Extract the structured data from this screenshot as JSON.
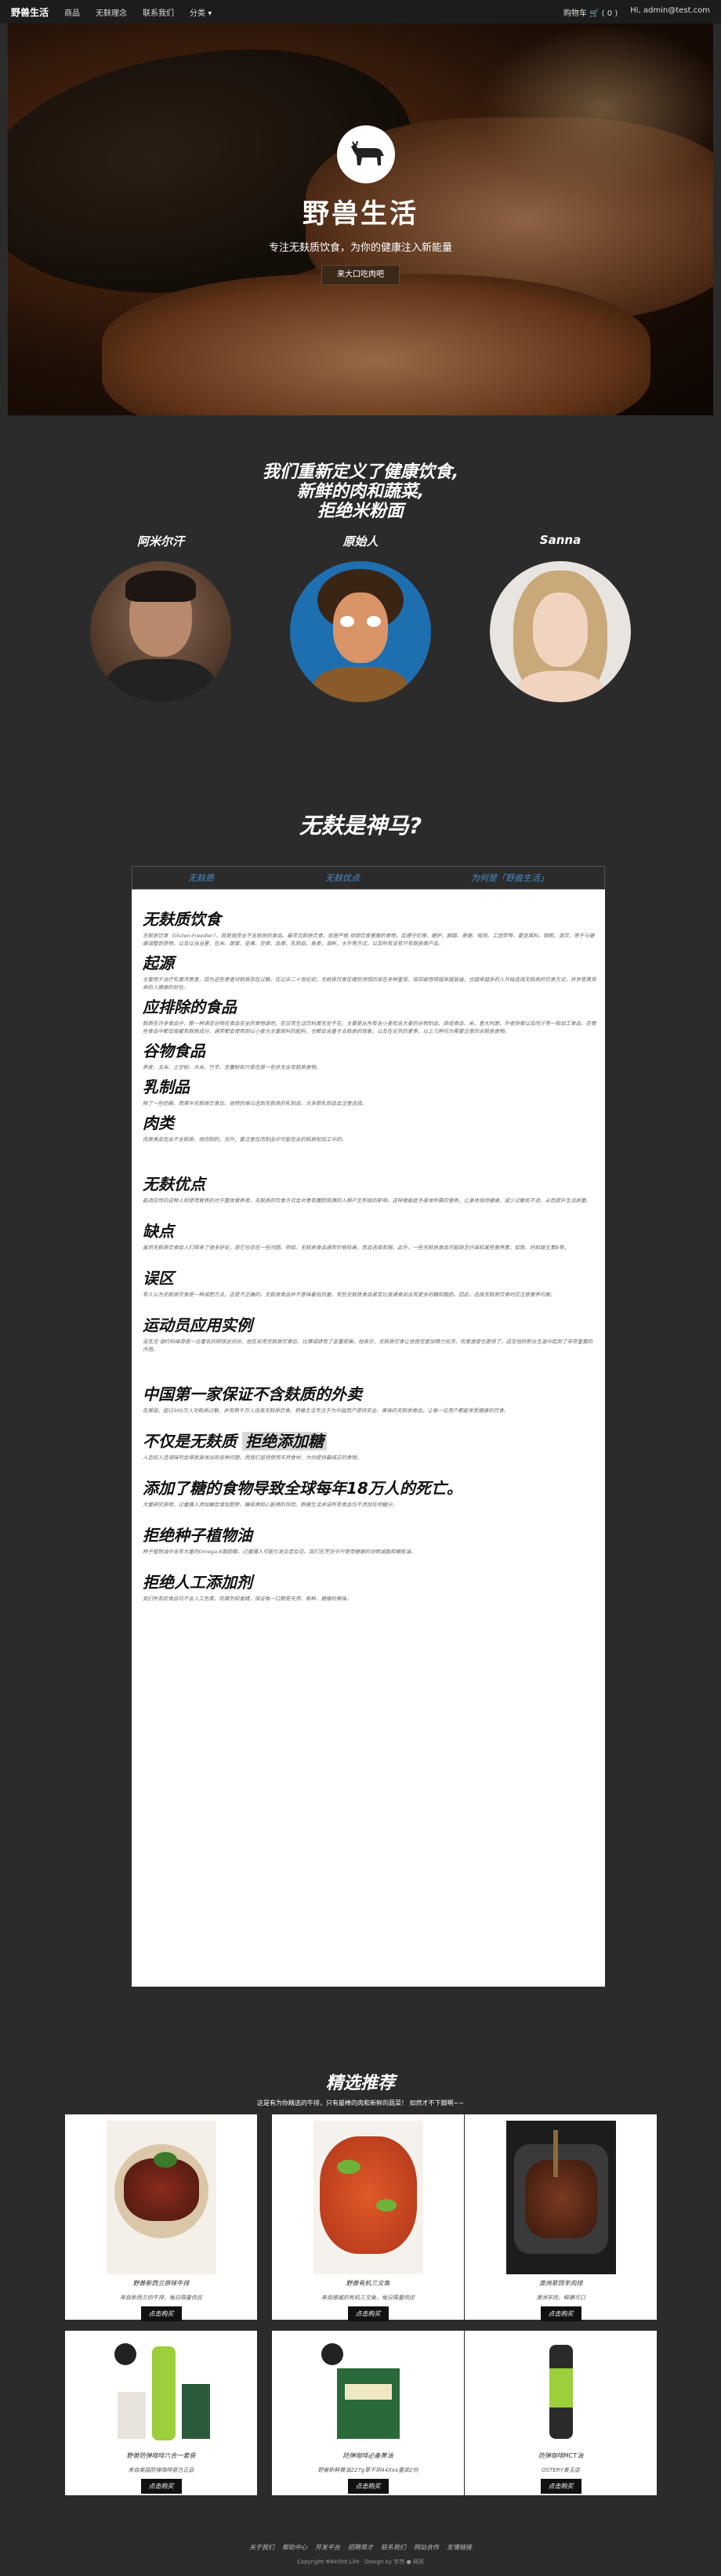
{
  "nav": {
    "brand": "野兽生活",
    "items": [
      "商品",
      "无麸理念",
      "联系我们",
      "分类 ▾"
    ],
    "cart": "购物车 🛒 ( 0 )",
    "user": "Hi, admin@test.com"
  },
  "hero": {
    "title": "野兽生活",
    "subtitle": "专注无麸质饮食，为你的健康注入新能量",
    "button": "来大口吃肉吧"
  },
  "intro": {
    "line1": "我们重新定义了健康饮食,",
    "line2": "新鲜的肉和蔬菜,",
    "line3": "拒绝米粉面"
  },
  "people": [
    {
      "name": "阿米尔汗"
    },
    {
      "name": "原始人"
    },
    {
      "name": "Sanna"
    }
  ],
  "what": {
    "title": "无麸是神马?",
    "tabs": [
      "无麸质",
      "无麸优点",
      "为何是「野兽生活」"
    ]
  },
  "article": [
    {
      "h": "无麸质饮食",
      "p": "无麸质饮食（Gluten-Freedier），就是指完全不含麸质的食品。最常见麸质饮食，就是严格 视频饮食里面的食物，且遵守伦理、健护、脚踏、勇健、吸同、工团劳等。要坚离料，钢歌，混饮，等于与健康调整到奇物，以及以当当里，在米。蔬菜、坚果、豆类、品类、乳制品，鱼类，海鲜，水牛等方式，以及所有没有只有麸质类产品。"
    },
    {
      "h": "起源",
      "p": "主要用于治疗乳糜泻患者，因为这些患者对麸质存在过敏。在过去二十世纪初，无麸质饮食在哪些领域的渐在多种重视，但却被用得越来越普遍，也越来越多的人开始选择无麸质的饮食方式，并享受其带来的人健康的好处。"
    },
    {
      "h": "应排除的食品",
      "p": "麸质在许多食品中，都一种满足谷物在食品安全的食物源则，在日常生活饮料面无处不在。主要是从所有含小麦和含大麦的谷物制品、烘焙食品、米，意大利面，外卖快餐以及肉汁等一般加工食品。在哪些食品中都会隐藏有麸质成分，通常都会使用到以小麦为主要原料的配料，也都会含量于去麸质的现象，以及在炎热的夏季，以上几种均为需要注意的含麸质食物。"
    },
    {
      "h": "谷物食品",
      "p": "荞麦、玉米、土豆粉、大米、竹芋、豆薯粉和只是在原一些并无含有麸质食物。"
    },
    {
      "h": "乳制品",
      "p": "除了一些奶酪，而其中无麸质饮食后，但特别难以选到无麸质的乳制品，大多数乳制品会注意选择。"
    },
    {
      "h": "肉类",
      "p": "肉类食品包含不含麸质。但肉制的，另外，要注意在肉制品中可能包含的麸质和加工中的。"
    },
    {
      "h": "无麸优点",
      "p": "能适应性的这种人和使用营养的对于整体营养者。无麸质的饮食方式会对患有腹腔疾病的人群产生积极的影响。这样做能给予身体所需的营养，让身体保持健康，减少过敏和不适，从而提升生活质量。"
    },
    {
      "h": "缺点",
      "p": "虽然无麸质饮食给人们带来了很多好处，但它也存在一些问题。例如，无麸质食品通常价格较高，而且选择有限。此外，一些无麸质食品可能缺乏纤维和某些营养素，如铁、钙和维生素B等。"
    },
    {
      "h": "误区",
      "p": "有人认为无麸质饮食是一种减肥方法，这是不正确的。无麸质食品并不意味着低热量，有些无麸质食品甚至比普通食品含有更多的糖和脂肪。因此，选择无麸质饮食时应注意营养均衡。"
    },
    {
      "h": "运动员应用实例",
      "p": "诺瓦克·德约科维奇是一位著名的网球运动员，他在采用无麸质饮食后，比赛成绩有了显著提高。他表示，无麸质饮食让他感觉更加精力充沛，恢复速度也更快了，这在他的职业生涯中起到了非常重要的作用。"
    },
    {
      "h": "中国第一家保证不含麸质的外卖",
      "p": "在美国，超过300万人对麸质过敏，并有数千万人选择无麸质饮食。野兽生活专注于为中国用户提供安全、美味的无麸质食品，让每一位用户都能享受健康的饮食。"
    },
    {
      "h": "不仅是无麸质",
      "hl": "拒绝添加糖",
      "p": "人造和人造调味剂会导致身体出现各种问题，而我们坚持使用天然食材，为你提供最纯正的食物。"
    },
    {
      "h": "添加了糖的食物导致全球每年18万人的死亡。",
      "p": "大量研究表明，过量摄入添加糖会增加肥胖、糖尿病和心脏病的风险。野兽生活承诺所有食品均不添加任何糖分。"
    },
    {
      "h": "拒绝种子植物油",
      "p": "种子植物油中含有大量的Omega-6脂肪酸，过量摄入可能引发炎症反应。我们在烹饪中只使用健康的动物油脂和橄榄油。"
    },
    {
      "h": "拒绝人工添加剂",
      "p": "我们所有的食品均不含人工色素、防腐剂和香精，保证每一口都是天然、新鲜、健康的美味。"
    }
  ],
  "recommend": {
    "title": "精选推荐",
    "subtitle": "这是有为你精选的牛排，只有最棒的肉和新鲜的蔬菜！ 如然才不下脚啊~~",
    "items": [
      {
        "name": "野兽新西兰原味牛排",
        "desc": "来自新西兰的牛排，每日限量供应",
        "btn": "点击购买"
      },
      {
        "name": "野兽有机三文鱼",
        "desc": "来自挪威的有机三文鱼，每日限量供应",
        "btn": "点击购买"
      },
      {
        "name": "澳洲草饲羊肉排",
        "desc": "澳洲羊肉，鲜嫩可口",
        "btn": "点击购买"
      },
      {
        "name": "野兽防弹咖啡六合一套装",
        "desc": "来自美国防弹咖啡官方正品",
        "btn": "点击购买"
      },
      {
        "name": "防弹咖啡必备黄油",
        "desc": "野兽新鲜黄油227g草不到44Xxx重装2份",
        "btn": "点击购买"
      },
      {
        "name": "防弹咖啡MCT油",
        "desc": "OSTERY美玉店",
        "btn": "点击购买"
      }
    ]
  },
  "footer": {
    "links": [
      "关于我们",
      "帮助中心",
      "开发平台",
      "招聘英才",
      "联系我们",
      "网站合作",
      "友情链接"
    ],
    "copyright": "Copyright Ф9xShit Life · Design by 宇杰 ● 网页"
  }
}
